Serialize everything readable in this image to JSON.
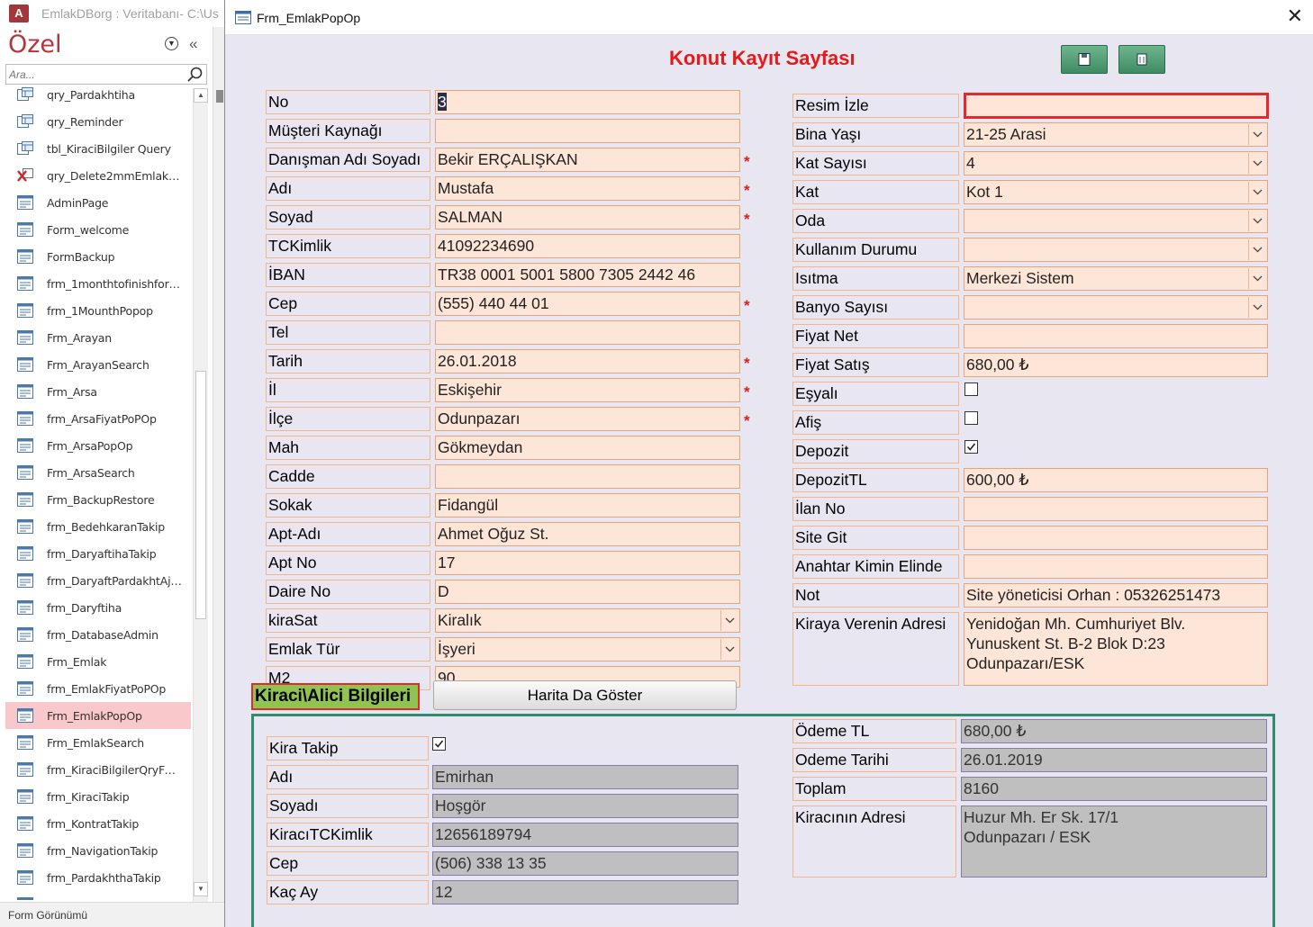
{
  "app": {
    "title": "EmlakDBorg : Veritabanı- C:\\Us",
    "logo": "A"
  },
  "nav": {
    "header": "Özel",
    "search_placeholder": "Ara...",
    "items": [
      {
        "label": "qry_Pardakhtiha",
        "icon": "query-icon"
      },
      {
        "label": "qry_Reminder",
        "icon": "query-icon"
      },
      {
        "label": "tbl_KiraciBilgiler Query",
        "icon": "query-icon"
      },
      {
        "label": "qry_Delete2mmEmlakAr...",
        "icon": "delete-query-icon"
      },
      {
        "label": "AdminPage",
        "icon": "form-icon"
      },
      {
        "label": "Form_welcome",
        "icon": "form-icon"
      },
      {
        "label": "FormBackup",
        "icon": "form-icon"
      },
      {
        "label": "frm_1monthtofinishforp...",
        "icon": "form-icon"
      },
      {
        "label": "frm_1MounthPopop",
        "icon": "form-icon"
      },
      {
        "label": "Frm_Arayan",
        "icon": "form-icon"
      },
      {
        "label": "Frm_ArayanSearch",
        "icon": "form-icon"
      },
      {
        "label": "Frm_Arsa",
        "icon": "form-icon"
      },
      {
        "label": "frm_ArsaFiyatPoPOp",
        "icon": "form-icon"
      },
      {
        "label": "Frm_ArsaPopOp",
        "icon": "form-icon"
      },
      {
        "label": "Frm_ArsaSearch",
        "icon": "form-icon"
      },
      {
        "label": "Frm_BackupRestore",
        "icon": "form-icon"
      },
      {
        "label": "frm_BedehkaranTakip",
        "icon": "form-icon"
      },
      {
        "label": "frm_DaryaftihaTakip",
        "icon": "form-icon"
      },
      {
        "label": "frm_DaryaftPardakhtAjn...",
        "icon": "form-icon"
      },
      {
        "label": "frm_Daryftiha",
        "icon": "form-icon"
      },
      {
        "label": "frm_DatabaseAdmin",
        "icon": "form-icon"
      },
      {
        "label": "Frm_Emlak",
        "icon": "form-icon"
      },
      {
        "label": "frm_EmlakFiyatPoPOp",
        "icon": "form-icon"
      },
      {
        "label": "Frm_EmlakPopOp",
        "icon": "form-icon",
        "selected": true
      },
      {
        "label": "Frm_EmlakSearch",
        "icon": "form-icon"
      },
      {
        "label": "frm_KiraciBilgilerQryForP...",
        "icon": "form-icon"
      },
      {
        "label": "frm_KiraciTakip",
        "icon": "form-icon"
      },
      {
        "label": "frm_KontratTakip",
        "icon": "form-icon"
      },
      {
        "label": "frm_NavigationTakip",
        "icon": "form-icon"
      },
      {
        "label": "frm_PardakhthaTakip",
        "icon": "form-icon"
      },
      {
        "label": "frm_PardakhtH...",
        "icon": "form-icon"
      }
    ]
  },
  "status_bar": "Form Görünümü",
  "popup": {
    "title": "Frm_EmlakPopOp"
  },
  "form": {
    "heading": "Konut Kayıt Sayfası",
    "left_fields": [
      {
        "label": "No",
        "value": "3",
        "required": false,
        "dropdown": false
      },
      {
        "label": "Müşteri Kaynağı",
        "value": "",
        "required": false,
        "dropdown": false
      },
      {
        "label": "Danışman Adı Soyadı",
        "value": "Bekir ERÇALIŞKAN",
        "required": true,
        "dropdown": false
      },
      {
        "label": "Adı",
        "value": "Mustafa",
        "required": true,
        "dropdown": false
      },
      {
        "label": "Soyad",
        "value": "SALMAN",
        "required": true,
        "dropdown": false
      },
      {
        "label": "TCKimlik",
        "value": "41092234690",
        "required": false,
        "dropdown": false
      },
      {
        "label": "İBAN",
        "value": "TR38 0001 5001 5800 7305 2442 46",
        "required": false,
        "dropdown": false
      },
      {
        "label": "Cep",
        "value": "(555) 440 44 01",
        "required": true,
        "dropdown": false
      },
      {
        "label": "Tel",
        "value": "",
        "required": false,
        "dropdown": false
      },
      {
        "label": "Tarih",
        "value": "26.01.2018",
        "required": true,
        "dropdown": false
      },
      {
        "label": "İl",
        "value": "Eskişehir",
        "required": true,
        "dropdown": false
      },
      {
        "label": "İlçe",
        "value": "Odunpazarı",
        "required": true,
        "dropdown": false
      },
      {
        "label": "Mah",
        "value": "Gökmeydan",
        "required": false,
        "dropdown": false
      },
      {
        "label": "Cadde",
        "value": "",
        "required": false,
        "dropdown": false
      },
      {
        "label": "Sokak",
        "value": "Fidangül",
        "required": false,
        "dropdown": false
      },
      {
        "label": "Apt-Adı",
        "value": "Ahmet Oğuz St.",
        "required": false,
        "dropdown": false
      },
      {
        "label": "Apt No",
        "value": "17",
        "required": false,
        "dropdown": false
      },
      {
        "label": "Daire No",
        "value": "D",
        "required": false,
        "dropdown": false
      },
      {
        "label": "kiraSat",
        "value": "Kiralık",
        "required": false,
        "dropdown": true
      },
      {
        "label": "Emlak Tür",
        "value": "İşyeri",
        "required": false,
        "dropdown": true
      },
      {
        "label": "M2",
        "value": "90",
        "required": false,
        "dropdown": false
      }
    ],
    "right_fields": [
      {
        "label": "Resim İzle",
        "value": "",
        "type": "text",
        "highlight": true
      },
      {
        "label": "Bina Yaşı",
        "value": "21-25 Arasi",
        "type": "dropdown"
      },
      {
        "label": "Kat Sayısı",
        "value": "4",
        "type": "dropdown"
      },
      {
        "label": "Kat",
        "value": "Kot  1",
        "type": "dropdown"
      },
      {
        "label": "Oda",
        "value": "",
        "type": "dropdown"
      },
      {
        "label": "Kullanım Durumu",
        "value": "",
        "type": "dropdown"
      },
      {
        "label": "Isıtma",
        "value": "Merkezi Sistem",
        "type": "dropdown"
      },
      {
        "label": "Banyo Sayısı",
        "value": "",
        "type": "dropdown"
      },
      {
        "label": "Fiyat Net",
        "value": "",
        "type": "text"
      },
      {
        "label": "Fiyat Satış",
        "value": "680,00 ₺",
        "type": "text"
      },
      {
        "label": "Eşyalı",
        "checked": false,
        "type": "checkbox"
      },
      {
        "label": "Afiş",
        "checked": false,
        "type": "checkbox"
      },
      {
        "label": "Depozit",
        "checked": true,
        "type": "checkbox"
      },
      {
        "label": "DepozitTL",
        "value": "600,00 ₺",
        "type": "text"
      },
      {
        "label": "İlan No",
        "value": "",
        "type": "text"
      },
      {
        "label": "Site Git",
        "value": "",
        "type": "text"
      },
      {
        "label": "Anahtar Kimin Elinde",
        "value": "",
        "type": "text"
      },
      {
        "label": "Not",
        "value": "Site yöneticisi Orhan : 05326251473",
        "type": "text"
      }
    ],
    "landlord_address": {
      "label": "Kiraya Verenin Adresi",
      "value": "Yenidoğan Mh. Cumhuriyet Blv.\nYunuskent St. B-2 Blok D:23\nOdunpazarı/ESK"
    },
    "tenant_section_title": "Kiraci\\Alici  Bilgileri",
    "map_button": "Harita Da Göster",
    "tenant": {
      "kira_takip": {
        "label": "Kira Takip",
        "checked": true
      },
      "fields": [
        {
          "label": "Adı",
          "value": "Emirhan"
        },
        {
          "label": "Soyadı",
          "value": "Hoşgör"
        },
        {
          "label": "KiracıTCKimlik",
          "value": "12656189794"
        },
        {
          "label": "Cep",
          "value": "(506) 338 13 35"
        },
        {
          "label": "Kaç Ay",
          "value": "12"
        }
      ],
      "payments": [
        {
          "label": "Ödeme TL",
          "value": "680,00 ₺"
        },
        {
          "label": "Odeme Tarihi",
          "value": "26.01.2019"
        },
        {
          "label": "Toplam",
          "value": "8160"
        }
      ],
      "address": {
        "label": "Kiracının Adresi",
        "value": "Huzur Mh. Er Sk. 17/1\nOdunpazarı / ESK"
      }
    }
  }
}
